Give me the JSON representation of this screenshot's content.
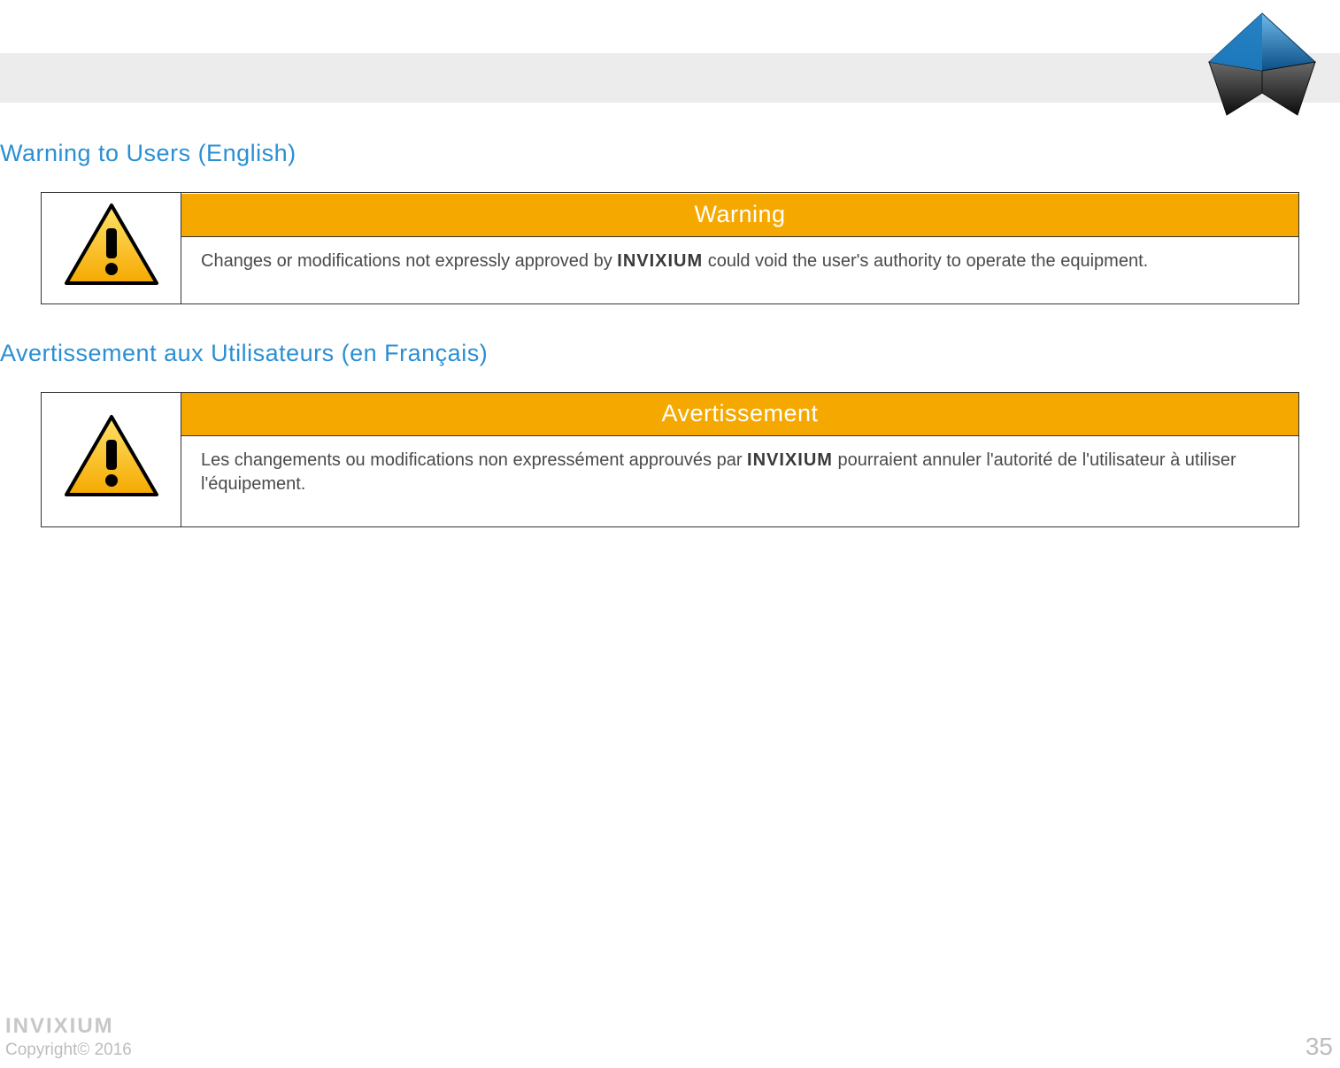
{
  "colors": {
    "heading_blue": "#2a8fd3",
    "warning_amber": "#f5a900",
    "band_grey": "#ececec",
    "text_grey": "#4a4a4a",
    "footer_grey": "#bdbdbd"
  },
  "sections": {
    "english": {
      "heading": "Warning to Users (English)",
      "title_bar": "Warning",
      "body_pre": "Changes or modifications not expressly approved by ",
      "brand": "INVIXIUM",
      "body_post": " could void the user's authority to operate the equipment."
    },
    "french": {
      "heading": "Avertissement aux Utilisateurs (en Français)",
      "title_bar": "Avertissement",
      "body_pre": "Les changements ou modifications non expressément approuvés par ",
      "brand": "INVIXIUM",
      "body_post": " pourraient annuler l'autorité de l'utilisateur à utiliser l'équipement."
    }
  },
  "footer": {
    "brand": "INVIXIUM",
    "copyright": "Copyright© 2016",
    "page": "35"
  },
  "icons": {
    "warning_icon": "warning-triangle-icon",
    "logo_icon": "invixium-logo-icon"
  }
}
